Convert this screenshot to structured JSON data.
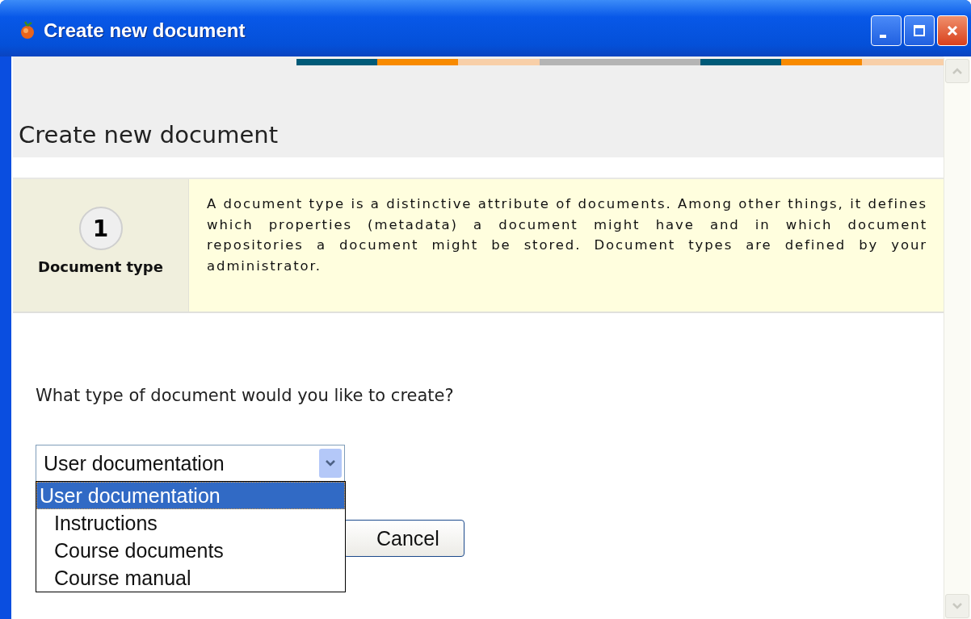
{
  "window": {
    "title": "Create new document"
  },
  "page": {
    "heading": "Create new document"
  },
  "step": {
    "number": "1",
    "label": "Document type",
    "description": "A document type is a distinctive attribute of documents. Among other things, it defines which properties (metadata) a document might have and in which document repositories a document might be stored. Document types are defined by your administrator."
  },
  "question": "What type of document would you like to create?",
  "document_type_select": {
    "value": "User documentation",
    "expanded": true,
    "options": [
      {
        "label": "User documentation",
        "selected": true
      },
      {
        "label": "Instructions",
        "selected": false
      },
      {
        "label": "Course documents",
        "selected": false
      },
      {
        "label": "Course manual",
        "selected": false
      }
    ]
  },
  "buttons": [
    "Cancel"
  ]
}
